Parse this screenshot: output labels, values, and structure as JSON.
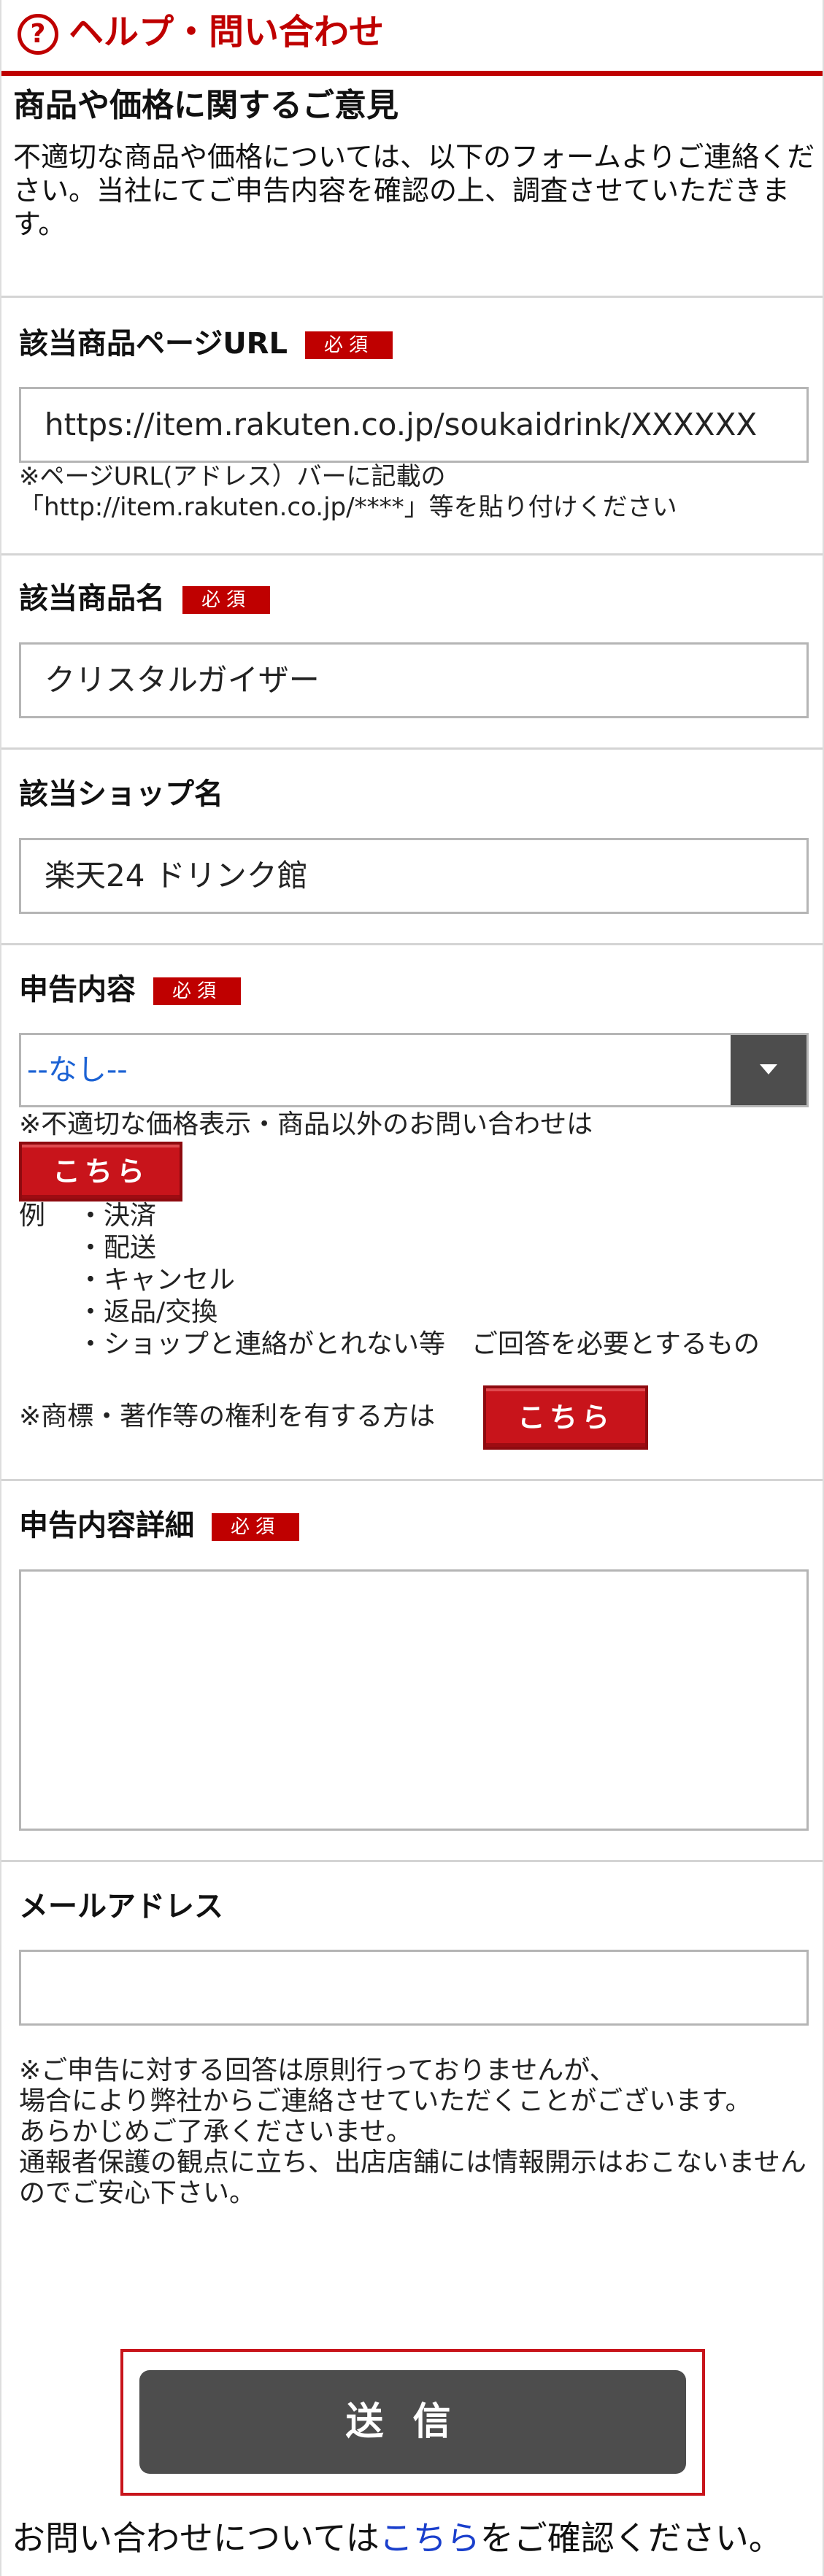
{
  "header": {
    "icon": "help-circle-icon",
    "icon_glyph": "?",
    "title": "ヘルプ・問い合わせ"
  },
  "intro": {
    "title": "商品や価格に関するご意見",
    "description": "不適切な商品や価格については、以下のフォームよりご連絡ください。当社にてご申告内容を確認の上、調査させていただきます。"
  },
  "required_label": "必須",
  "fields": {
    "url": {
      "label": "該当商品ページURL",
      "value": "https://item.rakuten.co.jp/soukaidrink/XXXXXX",
      "note_line1": "※ページURL(アドレス）バーに記載の",
      "note_line2": "「http://item.rakuten.co.jp/****」等を貼り付けください"
    },
    "product": {
      "label": "該当商品名",
      "value": "クリスタルガイザー"
    },
    "shop": {
      "label": "該当ショップ名",
      "value": "楽天24 ドリンク館"
    },
    "report": {
      "label": "申告内容",
      "selected": "--なし--",
      "note": "※不適切な価格表示・商品以外のお問い合わせは",
      "here_button": "こちら",
      "example_head": "例",
      "examples": [
        "・決済",
        "・配送",
        "・キャンセル",
        "・返品/交換",
        "・ショップと連絡がとれない等　ご回答を必要とするもの"
      ],
      "trademark_note": "※商標・著作等の権利を有する方は",
      "trademark_button": "こちら"
    },
    "details": {
      "label": "申告内容詳細",
      "value": ""
    },
    "email": {
      "label": "メールアドレス",
      "value": ""
    }
  },
  "disclaimer": [
    "※ご申告に対する回答は原則行っておりませんが、",
    "場合により弊社からご連絡させていただくことがございます。",
    "あらかじめご了承くださいませ。",
    "通報者保護の観点に立ち、出店店舗には情報開示はおこないませんのでご安心下さい。"
  ],
  "submit_label": "送信",
  "footer": {
    "prefix": "お問い合わせについては",
    "link": "こちら",
    "suffix": "をご確認ください。"
  },
  "colors": {
    "brand_red": "#bf0000",
    "select_text_blue": "#1b62d4",
    "link_blue": "#1a3fcc",
    "submit_gray": "#4d4d4d"
  }
}
